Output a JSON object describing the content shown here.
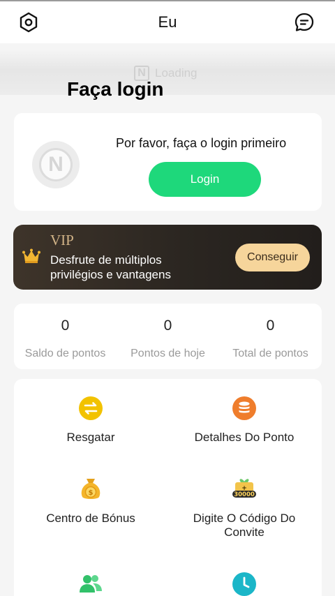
{
  "header": {
    "title": "Eu",
    "left_icon": "settings-hexagon-icon",
    "right_icon": "message-bubble-icon"
  },
  "loading": {
    "logo_letter": "N",
    "text": "Loading"
  },
  "overlay": {
    "heading": "Faça login"
  },
  "login_card": {
    "avatar_letter": "N",
    "prompt": "Por favor, faça o login primeiro",
    "button_label": "Login"
  },
  "vip": {
    "title": "VIP",
    "description": "Desfrute de múltiplos privilégios e vantagens",
    "button_label": "Conseguir"
  },
  "points": [
    {
      "value": "0",
      "label": "Saldo de pontos"
    },
    {
      "value": "0",
      "label": "Pontos de hoje"
    },
    {
      "value": "0",
      "label": "Total de pontos"
    }
  ],
  "menu": [
    {
      "label": "Resgatar",
      "icon": "exchange-icon"
    },
    {
      "label": "Detalhes Do Ponto",
      "icon": "coin-stack-icon"
    },
    {
      "label": "Centro de Bónus",
      "icon": "money-bag-icon"
    },
    {
      "label": "Digite O Código Do Convite",
      "icon": "invite-gift-icon",
      "badge": "30000"
    },
    {
      "label": "",
      "icon": "users-icon"
    },
    {
      "label": "",
      "icon": "clock-icon"
    }
  ],
  "colors": {
    "accent_green": "#1ed87b",
    "vip_gold": "#f6d59b",
    "vip_bg": "#2b2621"
  }
}
